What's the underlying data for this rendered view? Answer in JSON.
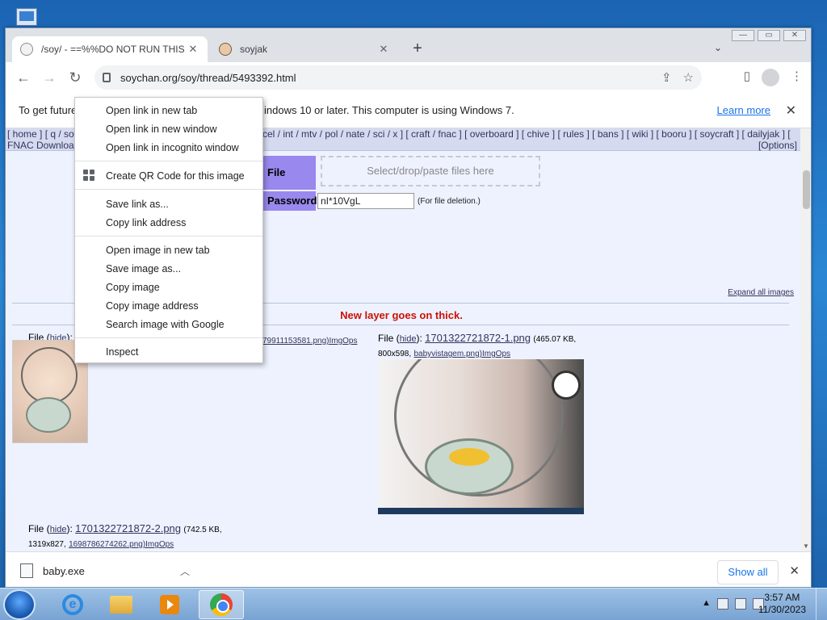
{
  "browser": {
    "tabs": [
      {
        "title": "/soy/ - ==%%DO NOT RUN THIS",
        "active": true
      },
      {
        "title": "soyjak",
        "active": false
      }
    ],
    "new_tab_glyph": "+",
    "tab_search_glyph": "⌄",
    "url": "soychan.org/soy/thread/5493392.html",
    "window_controls": [
      "—",
      "▭",
      "✕"
    ]
  },
  "infobar": {
    "text_left": "To get future",
    "text_right": "indows 10 or later. This computer is using Windows 7.",
    "learn_more": "Learn more",
    "close": "✕"
  },
  "page": {
    "boardnav_line1": "[ home ] [ q / soy",
    "boardnav_line1b": "cel / int / mtv / pol / nate / sci / x ] [ craft / fnac ] [ overboard ] [ chive ] [ rules ] [ bans ] [ wiki ] [ booru ] [ soycraft ] [ dailyjak ] [",
    "boardnav_line2": "FNAC Downloa",
    "options": "[Options]",
    "file_label": "File",
    "password_label": "Password",
    "dropzone": "Select/drop/paste files here",
    "password_value": "nI*10VgL",
    "password_hint": "(For file deletion.)",
    "expand_all": "Expand all images",
    "subject": "New layer goes on thick.",
    "posts": [
      {
        "file_prefix": "File",
        "hide": "hide",
        "fname": "",
        "meta_tail": "79911153581.png)ImgOps"
      },
      {
        "file_prefix": "File",
        "hide": "hide",
        "fname": "1701322721872-1.png",
        "size": "(465.07 KB,",
        "dims": "800x598,",
        "orig": "babyvistagem.png)ImgOps"
      },
      {
        "file_prefix": "File",
        "hide": "hide",
        "fname": "1701322721872-2.png",
        "size": "(742.5 KB,",
        "dims": "1319x827,",
        "orig": "1698786274262.png)ImgOps"
      }
    ]
  },
  "context_menu": {
    "items": [
      "Open link in new tab",
      "Open link in new window",
      "Open link in incognito window",
      "Create QR Code for this image",
      "Save link as...",
      "Copy link address",
      "Open image in new tab",
      "Save image as...",
      "Copy image",
      "Copy image address",
      "Search image with Google",
      "Inspect"
    ]
  },
  "downloads": {
    "filename": "baby.exe",
    "show_all": "Show all",
    "close": "✕"
  },
  "taskbar": {
    "time": "3:57 AM",
    "date": "11/30/2023"
  }
}
